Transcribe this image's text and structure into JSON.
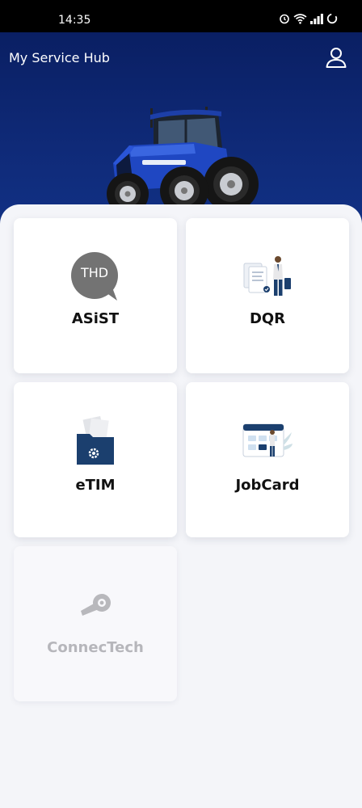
{
  "status_bar": {
    "time": "14:35"
  },
  "header": {
    "title": "My Service Hub",
    "background_color": "#0f2a78",
    "profile_icon": "user-icon"
  },
  "cards": [
    {
      "label": "ASiST",
      "icon": "thd-chat-icon",
      "icon_text": "THD",
      "enabled": true
    },
    {
      "label": "DQR",
      "icon": "document-person-icon",
      "enabled": true
    },
    {
      "label": "eTIM",
      "icon": "folder-gear-icon",
      "enabled": true
    },
    {
      "label": "JobCard",
      "icon": "calendar-person-icon",
      "enabled": true
    },
    {
      "label": "ConnecTech",
      "icon": "key-icon",
      "enabled": false
    }
  ],
  "colors": {
    "accent": "#1b3f6e",
    "disabled_text": "#b6b6bb"
  }
}
